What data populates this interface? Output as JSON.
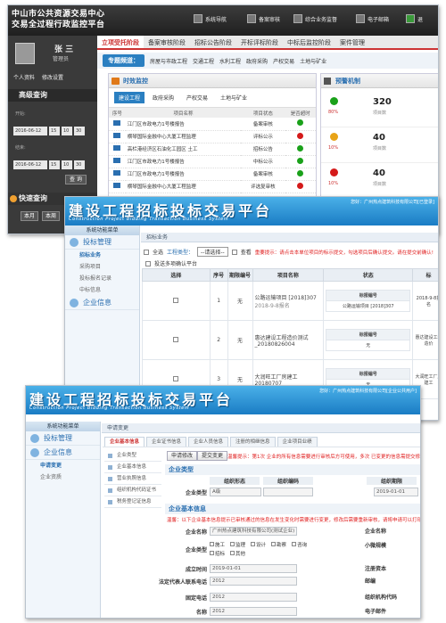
{
  "s1": {
    "logo_line1": "中山市公共资源交易中心",
    "logo_line2": "交易全过程行政监控平台",
    "top_nav": [
      "系统导航",
      "备案审核",
      "综合业务监督",
      "电子邮箱",
      "退"
    ],
    "user": {
      "name": "张 三",
      "role": "管理员",
      "links": [
        "个人资料",
        "修改设置"
      ]
    },
    "adv_search": {
      "title": "高级查询",
      "from_label": "开始:",
      "to_label": "结束:",
      "from_date": "2016-06-12",
      "to_date": "2016-06-12",
      "h1": "15",
      "m1": "10",
      "s1": "30",
      "h2": "15",
      "m2": "10",
      "s2": "30",
      "btn": "查 询"
    },
    "quick_search": {
      "title": "快速查询",
      "btns": [
        "本月",
        "本周"
      ]
    },
    "tabs": [
      "立项受托阶段",
      "备案审核阶段",
      "招标公告阶段",
      "开标评标阶段",
      "中标后监控阶段",
      "案件管理"
    ],
    "channel": {
      "label": "专题频道：",
      "items": [
        "房屋与市政工程",
        "交通工程",
        "水利工程",
        "政府采购",
        "产权交易",
        "土地与矿业"
      ]
    },
    "panel": {
      "title": "时效监控",
      "subtabs": [
        "建设工程",
        "政府采购",
        "产权交易",
        "土地与矿业"
      ],
      "cols": [
        "序号",
        "项目名称",
        "项目状态",
        "是否超时"
      ],
      "rows": [
        {
          "name": "江门区市政电力1号楼报告",
          "status": "备案审核",
          "color": "#1aa11a"
        },
        {
          "name": "横琴国际金融中心大厦工程监理",
          "status": "评标公示",
          "color": "#d41a1a"
        },
        {
          "name": "高栏港经济区石油化工园区 土工",
          "status": "招标公告",
          "color": "#1aa11a"
        },
        {
          "name": "江门区市政电力1号楼报告",
          "status": "中标公示",
          "color": "#1aa11a"
        },
        {
          "name": "江门区市政电力1号楼报告",
          "status": "备案审核",
          "color": "#1aa11a"
        },
        {
          "name": "横琴国际金融中心大厦工程监理",
          "status": "评选复审核",
          "color": "#d41a1a"
        }
      ]
    },
    "warning": {
      "title": "预警机制",
      "items": [
        {
          "color": "#1aa11a",
          "pct": "80%",
          "num": "320",
          "unit": "项目数"
        },
        {
          "color": "#e8a317",
          "pct": "10%",
          "num": "40",
          "unit": "项目数"
        },
        {
          "color": "#d41a1a",
          "pct": "10%",
          "num": "40",
          "unit": "项目数"
        }
      ]
    }
  },
  "s2": {
    "title": "建设工程招标投标交易平台",
    "subtitle": "Construction Project Bidding Transaction Business System",
    "welcome": "您好：广州热点建筑科技有限公司[已登录]",
    "menu_header": "系统功能菜单",
    "menu_sec1": "投标管理",
    "menu_items": [
      "招标业务",
      "采购项目",
      "投标报名记录",
      "中标信息"
    ],
    "menu_sec2": "企业信息",
    "crumb": "招标业务",
    "toolbar": {
      "check_all": "全选",
      "type_label": "工程类型：",
      "type_value": "--请选择--",
      "view_btn": "查看",
      "warn": "重要提示：请点击本单位项目的标示提交，勾选项目后确认提交。请在提交前确认!"
    },
    "check_label": "投送多项确认平台",
    "cols": [
      "选择",
      "序号",
      "期限编号",
      "项目名称",
      "状态",
      "标"
    ],
    "rows": [
      {
        "no": "1",
        "code": "无",
        "name": "公路运输项目 [2018]307",
        "date": "2018-9-8报名",
        "reg_label": "标报编号",
        "reg_val": "公路运输项目 [2018]307"
      },
      {
        "no": "2",
        "code": "无",
        "name": "惠达建设工程造价测试_20180826004",
        "date": "",
        "reg_label": "标报编号",
        "reg_val": "无"
      },
      {
        "no": "3",
        "code": "无",
        "name": "大润旺工厂房建工 20180707",
        "date": "",
        "reg_label": "标报编号",
        "reg_val": "无"
      }
    ],
    "row_extra": [
      "2018-9-8报名",
      "惠达建设工程造价",
      "大润旺工厂房建工"
    ]
  },
  "s3": {
    "title": "建设工程招标投标交易平台",
    "subtitle": "Construction Project Bidding Transaction Business System",
    "welcome": "您好：广州热点建筑科技有限公司[企业公共用户]",
    "menu_header": "系统功能菜单",
    "menu_sec1": "投标管理",
    "menu_sec2": "企业信息",
    "menu_items": [
      "申请变更",
      "企业资质"
    ],
    "crumb": "申请变更",
    "tabs": [
      "企业基本信息",
      "企业证书信息",
      "企业人员信息",
      "注册的相继信息",
      "企业项目业绩"
    ],
    "vnav": [
      "企业类型",
      "企业基本信息",
      "营业执照信息",
      "组织机构代码证书",
      "税务登记证信息"
    ],
    "btns": [
      "申请修改",
      "提交变更"
    ],
    "warn_text": "温馨提示：第1次 企业的所有信息需要进行审核后方可使用，多次 已变更的信息需提交修改，如果信息有变更请点击申请修改",
    "sec_type": "企业类型",
    "type_cols": [
      "组织形态",
      "组织编码",
      "",
      "组织期限"
    ],
    "type_label": "企业类型",
    "type_val": "A级",
    "type_date": "2019-01-01",
    "sec_basic": "企业基本信息",
    "basic_warn": "温馨：以下企业基本信息提示已审核通过的信息在发生变化时需要进行变更，修改后需要重新审核，请将申请可以打印信息证明",
    "f_name_label": "企业名称",
    "f_name_val": "广州热点建筑科技有限公司(测试企业)",
    "f_type_label": "企业类型",
    "f_checks": [
      "施工",
      "监理",
      "设计",
      "勘察",
      "咨询",
      "招标",
      "其他"
    ],
    "f_date_label": "成立时间",
    "f_date_val": "2019-01-01",
    "f_rep_label": "法定代表人联系电话",
    "f_rep_val": "2012",
    "f_tel_label": "固定电话",
    "f_tel_val": "2012",
    "f_email_label": "名称",
    "f_email_val": "2012",
    "right_labels": [
      "企业名称",
      "小微规模",
      "注册资本",
      "邮编",
      "组织机构代码",
      "电子邮件"
    ]
  }
}
